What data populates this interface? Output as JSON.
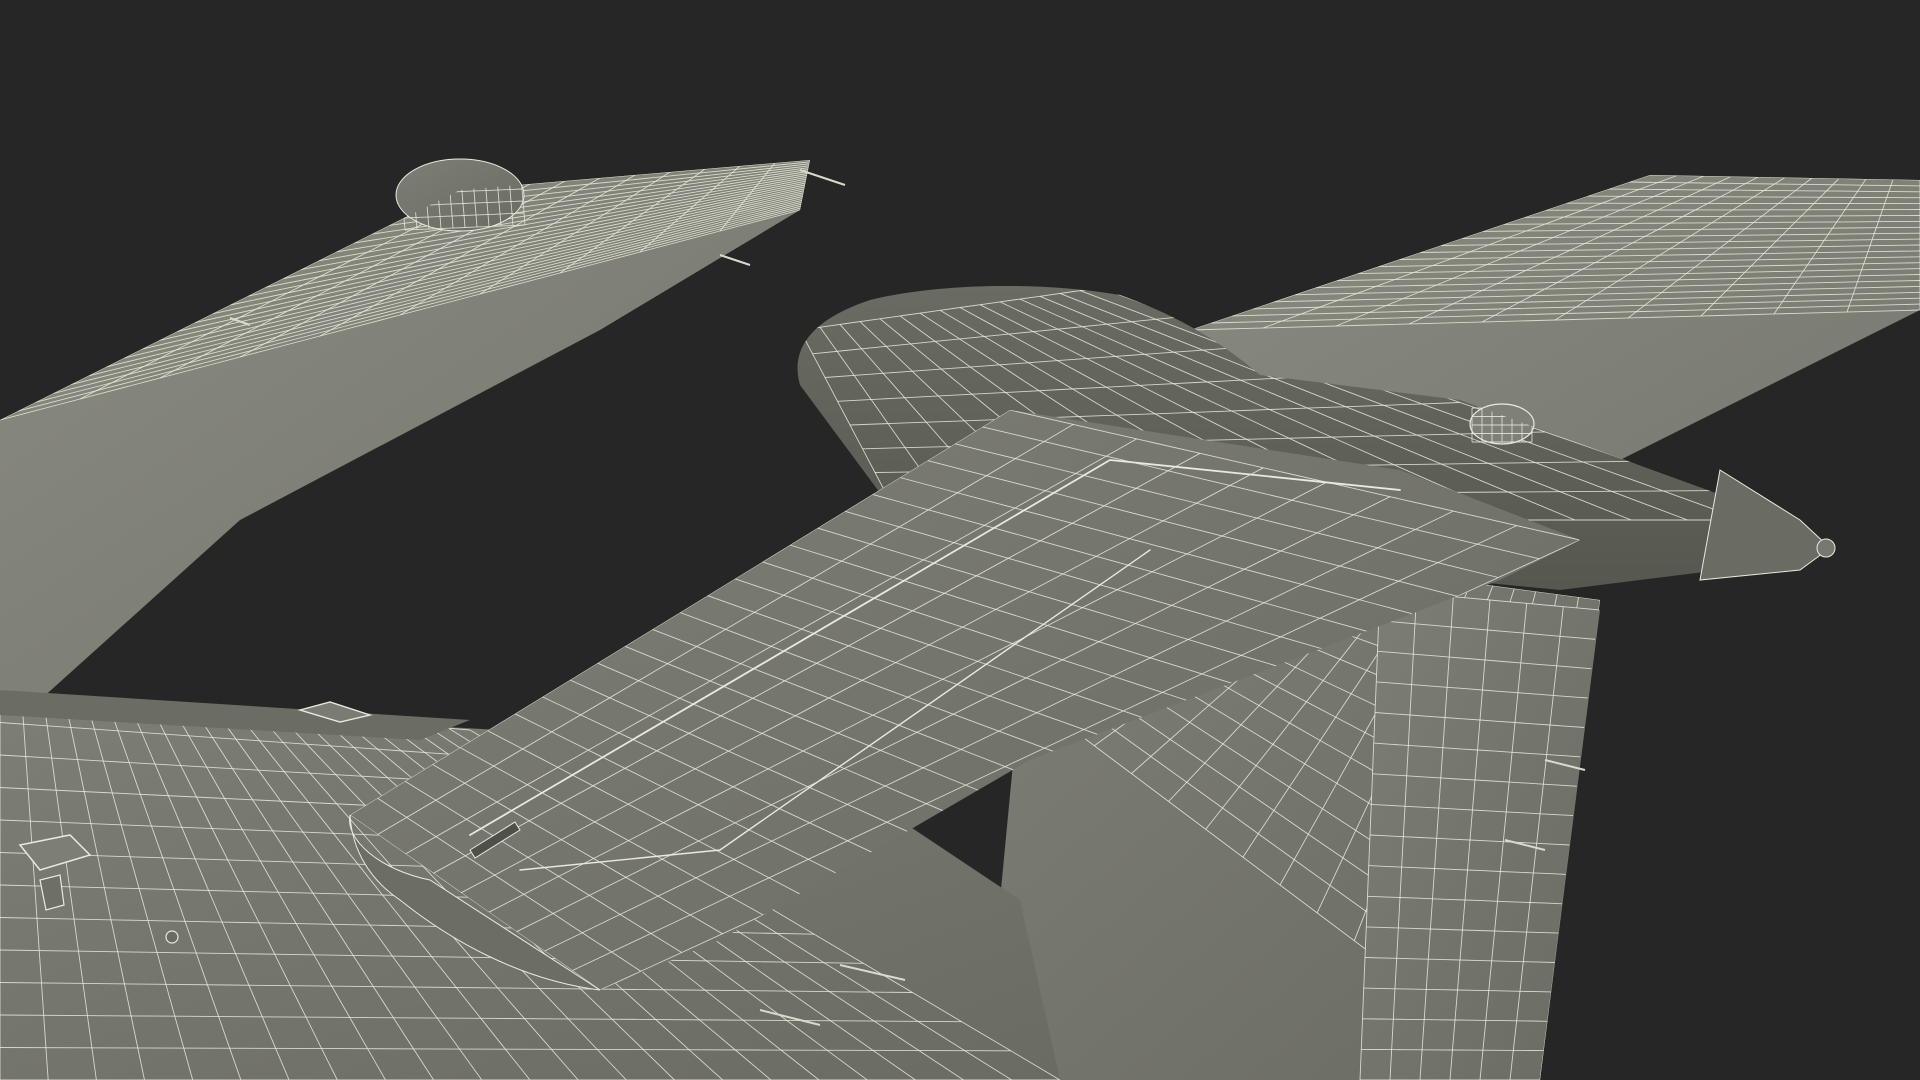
{
  "scene": {
    "subject": "aircraft-tail-wireframe",
    "colors": {
      "background": "#262626",
      "skin_light": "#83847a",
      "skin_mid": "#76776e",
      "skin_dark": "#5f6058",
      "wire": "#e9eadc"
    }
  }
}
